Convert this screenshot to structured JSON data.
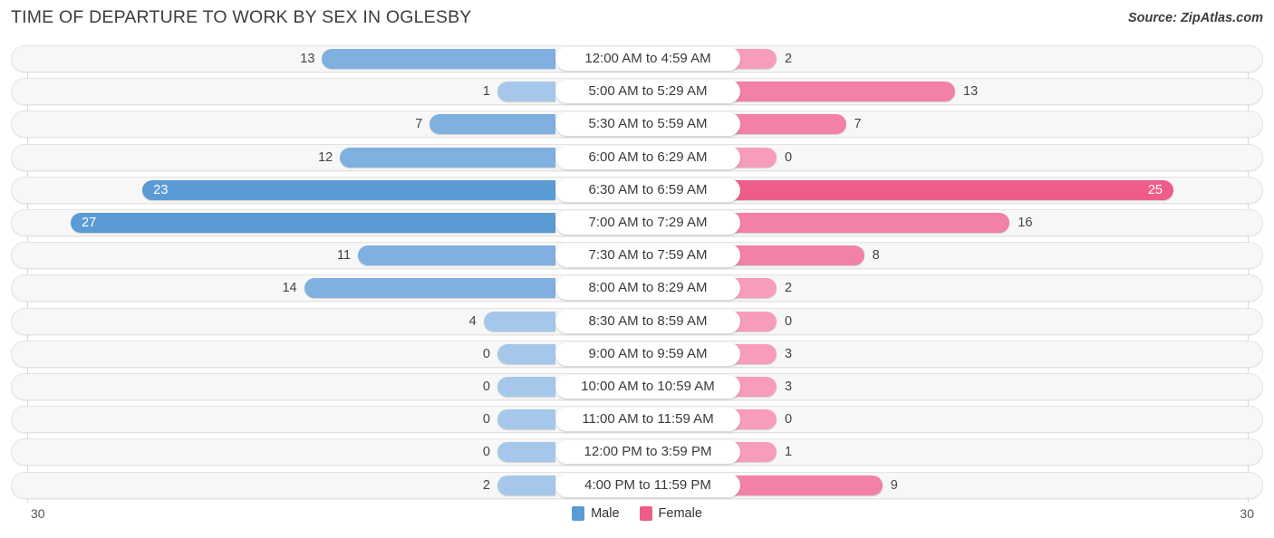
{
  "header": {
    "title": "TIME OF DEPARTURE TO WORK BY SEX IN OGLESBY",
    "source": "Source: ZipAtlas.com"
  },
  "legend": {
    "position": "bottom-center",
    "items": [
      {
        "label": "Male",
        "color": "#5B9BD5"
      },
      {
        "label": "Female",
        "color": "#EE5D8A"
      }
    ]
  },
  "axis": {
    "left_tick": "30",
    "right_tick": "30"
  },
  "colors": {
    "male_light": "#A5C8EA",
    "male_mid": "#7FB0E0",
    "male_strong": "#5B9BD5",
    "female_light": "#F79CBC",
    "female_mid": "#F280A8",
    "female_strong": "#EE5D8A",
    "track_fill": "#F7F7F7",
    "track_border": "#E3E3E3",
    "pill_fill": "#FFFFFF",
    "gridline": "#D8D8D8"
  },
  "chart_data": {
    "type": "bar",
    "orientation": "horizontal-diverging",
    "title": "TIME OF DEPARTURE TO WORK BY SEX IN OGLESBY",
    "xlabel": "",
    "ylabel": "",
    "xlim": [
      30,
      30
    ],
    "grid": false,
    "categories": [
      "12:00 AM to 4:59 AM",
      "5:00 AM to 5:29 AM",
      "5:30 AM to 5:59 AM",
      "6:00 AM to 6:29 AM",
      "6:30 AM to 6:59 AM",
      "7:00 AM to 7:29 AM",
      "7:30 AM to 7:59 AM",
      "8:00 AM to 8:29 AM",
      "8:30 AM to 8:59 AM",
      "9:00 AM to 9:59 AM",
      "10:00 AM to 10:59 AM",
      "11:00 AM to 11:59 AM",
      "12:00 PM to 3:59 PM",
      "4:00 PM to 11:59 PM"
    ],
    "series": [
      {
        "name": "Male",
        "values": [
          13,
          1,
          7,
          12,
          23,
          27,
          11,
          14,
          4,
          0,
          0,
          0,
          0,
          2
        ]
      },
      {
        "name": "Female",
        "values": [
          2,
          13,
          7,
          0,
          25,
          16,
          8,
          2,
          0,
          3,
          3,
          0,
          1,
          9
        ]
      }
    ]
  },
  "rows": [
    {
      "label": "12:00 AM to 4:59 AM",
      "male": "13",
      "female": "2"
    },
    {
      "label": "5:00 AM to 5:29 AM",
      "male": "1",
      "female": "13"
    },
    {
      "label": "5:30 AM to 5:59 AM",
      "male": "7",
      "female": "7"
    },
    {
      "label": "6:00 AM to 6:29 AM",
      "male": "12",
      "female": "0"
    },
    {
      "label": "6:30 AM to 6:59 AM",
      "male": "23",
      "female": "25"
    },
    {
      "label": "7:00 AM to 7:29 AM",
      "male": "27",
      "female": "16"
    },
    {
      "label": "7:30 AM to 7:59 AM",
      "male": "11",
      "female": "8"
    },
    {
      "label": "8:00 AM to 8:29 AM",
      "male": "14",
      "female": "2"
    },
    {
      "label": "8:30 AM to 8:59 AM",
      "male": "4",
      "female": "0"
    },
    {
      "label": "9:00 AM to 9:59 AM",
      "male": "0",
      "female": "3"
    },
    {
      "label": "10:00 AM to 10:59 AM",
      "male": "0",
      "female": "3"
    },
    {
      "label": "11:00 AM to 11:59 AM",
      "male": "0",
      "female": "0"
    },
    {
      "label": "12:00 PM to 3:59 PM",
      "male": "0",
      "female": "1"
    },
    {
      "label": "4:00 PM to 11:59 PM",
      "male": "2",
      "female": "9"
    }
  ]
}
